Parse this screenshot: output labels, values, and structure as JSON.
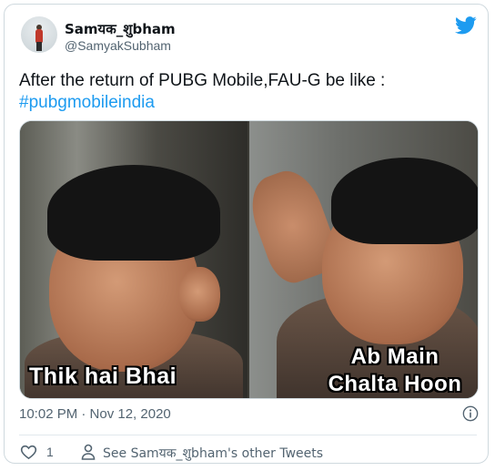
{
  "tweet": {
    "display_name": "Samयक_शुbham",
    "handle": "@SamyakSubham",
    "text": "After the return of PUBG Mobile,FAU-G be like :",
    "hashtag": "#pubgmobileindia",
    "media": {
      "left_caption": "Thik hai Bhai",
      "right_caption_line1": "Ab Main",
      "right_caption_line2": "Chalta Hoon"
    },
    "timestamp": "10:02 PM · Nov 12, 2020",
    "likes": "1",
    "see_more": "See Samयक_शुbham's other Tweets"
  },
  "colors": {
    "accent": "#1d9bf0",
    "text": "#0f1419",
    "secondary": "#536471"
  },
  "icons": [
    "twitter-bird-icon",
    "info-icon",
    "heart-icon",
    "person-icon"
  ]
}
